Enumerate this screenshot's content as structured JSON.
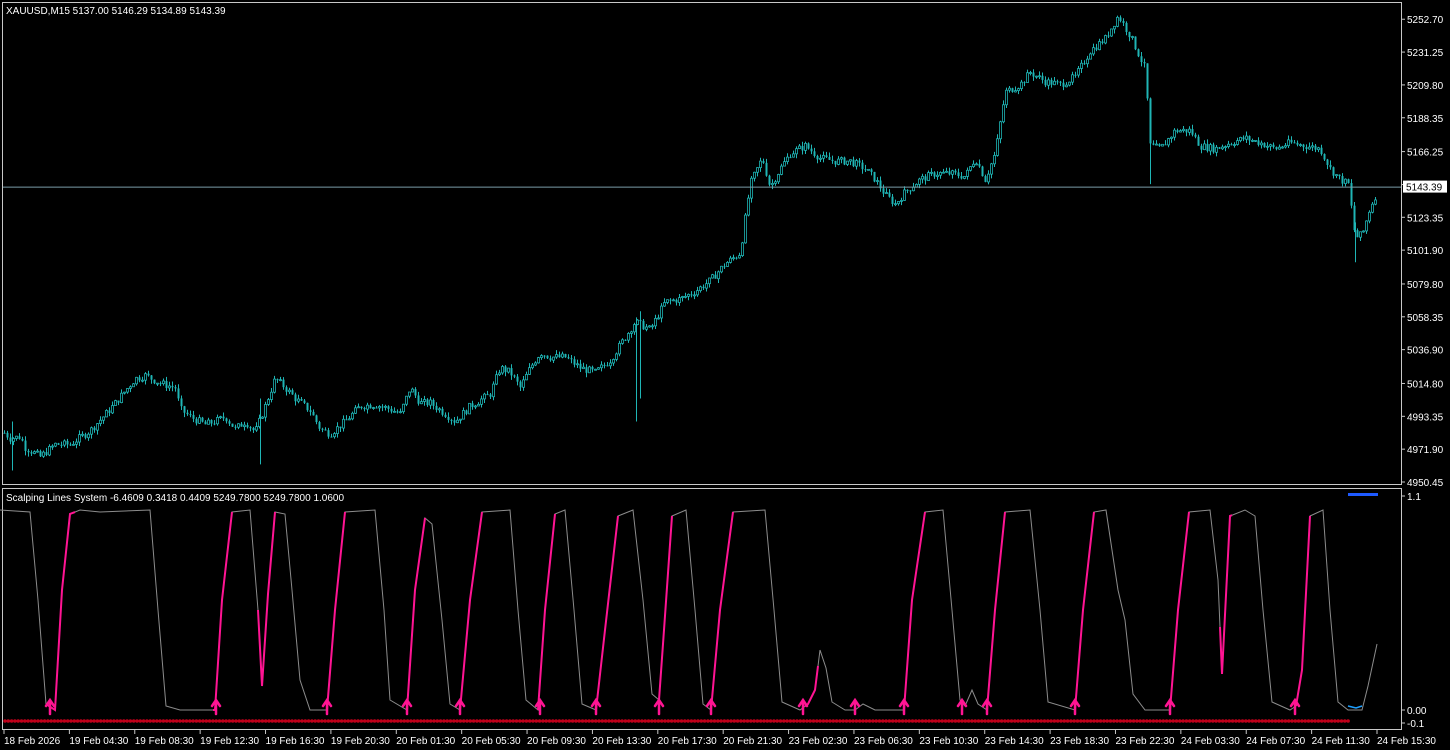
{
  "window": {
    "symbol_title": "XAUUSD,M15  5137.00 5146.29 5134.89 5143.39",
    "indicator_title": "Scalping Lines System -6.4609 0.3418 0.4409 5249.7800 5249.7800 1.0600"
  },
  "colors": {
    "background": "#000000",
    "candle": "#1fb5b5",
    "price_line": "#7a9ca8",
    "axis_text": "#ffffff",
    "osc_line": "#8c8c8c",
    "osc_up": "#ff1493",
    "arrow": "#ff1493",
    "dots": "#c0001a",
    "marker_blue": "#1e5aff"
  },
  "chart_data": [
    {
      "type": "candlestick",
      "title": "XAUUSD,M15  5137.00 5146.29 5134.89 5143.39",
      "ylim": [
        4950.45,
        5262
      ],
      "yticks": [
        "5252.70",
        "5231.25",
        "5209.80",
        "5188.35",
        "5166.25",
        "5144.75",
        "5123.35",
        "5101.90",
        "5079.80",
        "5058.35",
        "5036.90",
        "5014.80",
        "4993.35",
        "4971.90",
        "4950.45"
      ],
      "current_price": "5143.39",
      "xticks": [
        "18 Feb 2026",
        "19 Feb 04:30",
        "19 Feb 08:30",
        "19 Feb 12:30",
        "19 Feb 16:30",
        "19 Feb 20:30",
        "20 Feb 01:30",
        "20 Feb 05:30",
        "20 Feb 09:30",
        "20 Feb 13:30",
        "20 Feb 17:30",
        "20 Feb 21:30",
        "23 Feb 02:30",
        "23 Feb 06:30",
        "23 Feb 10:30",
        "23 Feb 14:30",
        "23 Feb 18:30",
        "23 Feb 22:30",
        "24 Feb 03:30",
        "24 Feb 07:30",
        "24 Feb 11:30",
        "24 Feb 15:30"
      ],
      "price_path": [
        [
          0,
          4985
        ],
        [
          10,
          4979
        ],
        [
          20,
          4980
        ],
        [
          25,
          4973
        ],
        [
          40,
          4967
        ],
        [
          55,
          4975
        ],
        [
          70,
          4975
        ],
        [
          90,
          4984
        ],
        [
          110,
          4998
        ],
        [
          125,
          5010
        ],
        [
          135,
          5018
        ],
        [
          145,
          5020
        ],
        [
          160,
          5015
        ],
        [
          175,
          5012
        ],
        [
          180,
          4998
        ],
        [
          190,
          4993
        ],
        [
          205,
          4988
        ],
        [
          215,
          4990
        ],
        [
          225,
          4993
        ],
        [
          235,
          4985
        ],
        [
          245,
          4990
        ],
        [
          255,
          4983
        ],
        [
          265,
          5000
        ],
        [
          275,
          5018
        ],
        [
          285,
          5012
        ],
        [
          295,
          5005
        ],
        [
          310,
          4997
        ],
        [
          320,
          4985
        ],
        [
          330,
          4982
        ],
        [
          345,
          4990
        ],
        [
          360,
          5000
        ],
        [
          375,
          5001
        ],
        [
          390,
          4998
        ],
        [
          400,
          4995
        ],
        [
          410,
          5012
        ],
        [
          420,
          5002
        ],
        [
          430,
          5002
        ],
        [
          445,
          4995
        ],
        [
          455,
          4990
        ],
        [
          470,
          5000
        ],
        [
          490,
          5008
        ],
        [
          500,
          5025
        ],
        [
          510,
          5022
        ],
        [
          520,
          5012
        ],
        [
          530,
          5025
        ],
        [
          540,
          5035
        ],
        [
          550,
          5032
        ],
        [
          565,
          5032
        ],
        [
          580,
          5025
        ],
        [
          595,
          5022
        ],
        [
          610,
          5030
        ],
        [
          620,
          5040
        ],
        [
          635,
          5055
        ],
        [
          650,
          5050
        ],
        [
          665,
          5068
        ],
        [
          680,
          5070
        ],
        [
          695,
          5075
        ],
        [
          710,
          5082
        ],
        [
          725,
          5093
        ],
        [
          740,
          5100
        ],
        [
          750,
          5145
        ],
        [
          762,
          5162
        ],
        [
          770,
          5143
        ],
        [
          780,
          5155
        ],
        [
          790,
          5165
        ],
        [
          805,
          5170
        ],
        [
          820,
          5162
        ],
        [
          835,
          5160
        ],
        [
          850,
          5160
        ],
        [
          865,
          5155
        ],
        [
          875,
          5148
        ],
        [
          885,
          5138
        ],
        [
          895,
          5132
        ],
        [
          905,
          5140
        ],
        [
          920,
          5148
        ],
        [
          935,
          5152
        ],
        [
          950,
          5152
        ],
        [
          965,
          5150
        ],
        [
          975,
          5162
        ],
        [
          985,
          5148
        ],
        [
          995,
          5165
        ],
        [
          1005,
          5205
        ],
        [
          1020,
          5210
        ],
        [
          1030,
          5218
        ],
        [
          1045,
          5212
        ],
        [
          1060,
          5210
        ],
        [
          1075,
          5215
        ],
        [
          1090,
          5232
        ],
        [
          1105,
          5240
        ],
        [
          1118,
          5255
        ],
        [
          1130,
          5242
        ],
        [
          1145,
          5220
        ],
        [
          1150,
          5170
        ],
        [
          1160,
          5168
        ],
        [
          1175,
          5180
        ],
        [
          1190,
          5180
        ],
        [
          1200,
          5170
        ],
        [
          1215,
          5168
        ],
        [
          1230,
          5172
        ],
        [
          1245,
          5175
        ],
        [
          1260,
          5172
        ],
        [
          1275,
          5168
        ],
        [
          1290,
          5172
        ],
        [
          1305,
          5170
        ],
        [
          1320,
          5168
        ],
        [
          1330,
          5155
        ],
        [
          1340,
          5148
        ],
        [
          1348,
          5145
        ],
        [
          1355,
          5110
        ],
        [
          1362,
          5112
        ],
        [
          1370,
          5130
        ],
        [
          1377,
          5140
        ]
      ],
      "wick_spikes": [
        [
          12,
          4958,
          4990
        ],
        [
          260,
          4962,
          5005
        ],
        [
          636,
          4990,
          5058
        ],
        [
          640,
          5005,
          5062
        ],
        [
          1150,
          5145,
          5175
        ],
        [
          1355,
          5094,
          5120
        ]
      ]
    },
    {
      "type": "line",
      "title": "Scalping Lines System -6.4609 0.3418 0.4409 5249.7800 5249.7800 1.0600",
      "ylim": [
        -0.1,
        1.1
      ],
      "yticks": [
        "1.1",
        "0.00",
        "-0.1"
      ],
      "line": [
        [
          0,
          1.0
        ],
        [
          30,
          0.99
        ],
        [
          38,
          0.55
        ],
        [
          46,
          0.03
        ],
        [
          55,
          0.0
        ],
        [
          62,
          0.6
        ],
        [
          70,
          0.98
        ],
        [
          80,
          1.0
        ],
        [
          100,
          0.99
        ],
        [
          150,
          1.0
        ],
        [
          158,
          0.5
        ],
        [
          166,
          0.02
        ],
        [
          180,
          0.0
        ],
        [
          215,
          0.0
        ],
        [
          222,
          0.55
        ],
        [
          232,
          0.99
        ],
        [
          250,
          1.0
        ],
        [
          258,
          0.5
        ],
        [
          262,
          0.12
        ],
        [
          268,
          0.58
        ],
        [
          275,
          0.99
        ],
        [
          285,
          0.98
        ],
        [
          292,
          0.6
        ],
        [
          300,
          0.15
        ],
        [
          310,
          0.0
        ],
        [
          327,
          0.0
        ],
        [
          335,
          0.5
        ],
        [
          345,
          0.99
        ],
        [
          375,
          1.0
        ],
        [
          384,
          0.5
        ],
        [
          390,
          0.05
        ],
        [
          407,
          0.0
        ],
        [
          415,
          0.6
        ],
        [
          425,
          0.96
        ],
        [
          432,
          0.93
        ],
        [
          442,
          0.45
        ],
        [
          450,
          0.03
        ],
        [
          460,
          0.0
        ],
        [
          470,
          0.55
        ],
        [
          482,
          0.99
        ],
        [
          510,
          1.0
        ],
        [
          518,
          0.5
        ],
        [
          526,
          0.05
        ],
        [
          538,
          0.0
        ],
        [
          545,
          0.5
        ],
        [
          555,
          0.98
        ],
        [
          565,
          1.0
        ],
        [
          574,
          0.5
        ],
        [
          582,
          0.03
        ],
        [
          596,
          0.0
        ],
        [
          605,
          0.4
        ],
        [
          618,
          0.97
        ],
        [
          633,
          1.0
        ],
        [
          643,
          0.55
        ],
        [
          652,
          0.08
        ],
        [
          659,
          0.05
        ],
        [
          664,
          0.4
        ],
        [
          672,
          0.97
        ],
        [
          686,
          1.0
        ],
        [
          695,
          0.5
        ],
        [
          703,
          0.03
        ],
        [
          711,
          0.0
        ],
        [
          720,
          0.5
        ],
        [
          733,
          0.99
        ],
        [
          765,
          1.0
        ],
        [
          774,
          0.5
        ],
        [
          782,
          0.04
        ],
        [
          800,
          0.0
        ],
        [
          808,
          0.03
        ],
        [
          815,
          0.1
        ],
        [
          820,
          0.3
        ],
        [
          826,
          0.21
        ],
        [
          832,
          0.04
        ],
        [
          845,
          0.0
        ],
        [
          855,
          0.0
        ],
        [
          863,
          0.03
        ],
        [
          875,
          0.0
        ],
        [
          904,
          0.0
        ],
        [
          912,
          0.55
        ],
        [
          925,
          0.99
        ],
        [
          943,
          1.0
        ],
        [
          952,
          0.5
        ],
        [
          960,
          0.05
        ],
        [
          965,
          0.02
        ],
        [
          972,
          0.1
        ],
        [
          978,
          0.03
        ],
        [
          987,
          0.0
        ],
        [
          995,
          0.5
        ],
        [
          1005,
          0.99
        ],
        [
          1030,
          1.0
        ],
        [
          1040,
          0.5
        ],
        [
          1048,
          0.04
        ],
        [
          1075,
          0.0
        ],
        [
          1083,
          0.5
        ],
        [
          1094,
          0.99
        ],
        [
          1106,
          1.0
        ],
        [
          1112,
          0.8
        ],
        [
          1118,
          0.6
        ],
        [
          1125,
          0.45
        ],
        [
          1133,
          0.08
        ],
        [
          1145,
          0.0
        ],
        [
          1170,
          0.0
        ],
        [
          1178,
          0.5
        ],
        [
          1189,
          0.99
        ],
        [
          1210,
          1.0
        ],
        [
          1218,
          0.65
        ],
        [
          1222,
          0.18
        ],
        [
          1230,
          0.97
        ],
        [
          1245,
          1.0
        ],
        [
          1255,
          0.97
        ],
        [
          1263,
          0.5
        ],
        [
          1272,
          0.04
        ],
        [
          1290,
          0.0
        ],
        [
          1296,
          0.02
        ],
        [
          1302,
          0.2
        ],
        [
          1310,
          0.97
        ],
        [
          1323,
          1.0
        ],
        [
          1330,
          0.5
        ],
        [
          1338,
          0.04
        ],
        [
          1348,
          0.0
        ],
        [
          1362,
          0.0
        ],
        [
          1368,
          0.12
        ],
        [
          1377,
          0.33
        ]
      ],
      "up_segments": [
        [
          46,
          75
        ],
        [
          213,
          232
        ],
        [
          258,
          275
        ],
        [
          327,
          345
        ],
        [
          407,
          425
        ],
        [
          460,
          482
        ],
        [
          538,
          555
        ],
        [
          596,
          618
        ],
        [
          659,
          672
        ],
        [
          711,
          733
        ],
        [
          805,
          818
        ],
        [
          904,
          925
        ],
        [
          987,
          1005
        ],
        [
          1075,
          1094
        ],
        [
          1170,
          1189
        ],
        [
          1220,
          1232
        ],
        [
          1296,
          1310
        ]
      ],
      "arrows": [
        50,
        216,
        327,
        407,
        460,
        540,
        596,
        659,
        711,
        803,
        855,
        904,
        962,
        987,
        1075,
        1170,
        1295
      ]
    }
  ]
}
